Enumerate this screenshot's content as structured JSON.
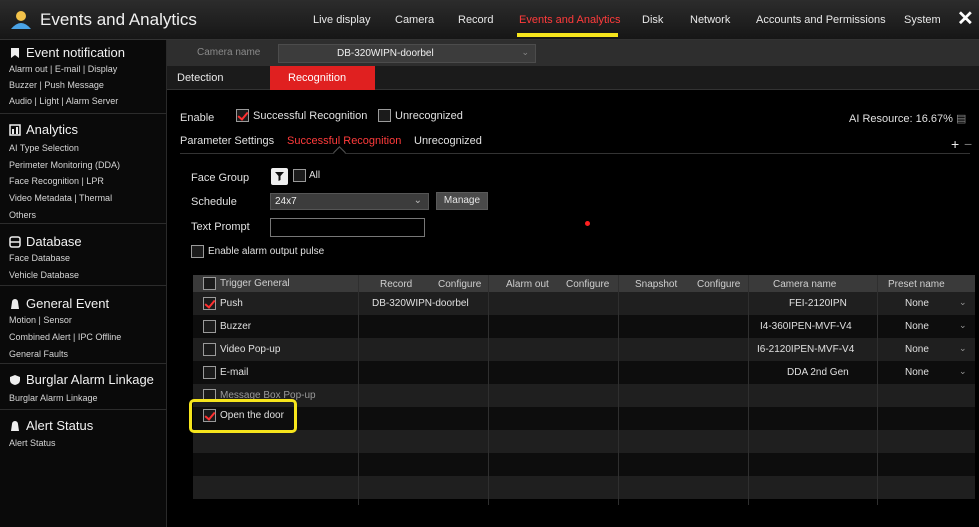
{
  "app": {
    "title": "Events and Analytics"
  },
  "nav": [
    "Live display",
    "Camera",
    "Record",
    "Events and Analytics",
    "Disk",
    "Network",
    "Accounts and Permissions",
    "System"
  ],
  "nav_active_index": 3,
  "close": "✕",
  "sidebar": {
    "sections": [
      {
        "title": "Event notification",
        "icon": "event-notification-icon",
        "items": [
          "Alarm out | E-mail | Display",
          "Buzzer | Push Message",
          "Audio | Light | Alarm Server"
        ]
      },
      {
        "title": "Analytics",
        "icon": "analytics-icon",
        "items": [
          "AI Type Selection",
          "Perimeter Monitoring (DDA)",
          "Face Recognition | LPR",
          "Video Metadata | Thermal",
          "Others"
        ]
      },
      {
        "title": "Database",
        "icon": "database-icon",
        "items": [
          "Face Database",
          "Vehicle Database"
        ]
      },
      {
        "title": "General Event",
        "icon": "general-event-icon",
        "items": [
          "Motion | Sensor",
          "Combined Alert | IPC Offline",
          "General Faults"
        ]
      },
      {
        "title": "Burglar Alarm Linkage",
        "icon": "shield-icon",
        "items": [
          "Burglar Alarm Linkage"
        ]
      },
      {
        "title": "Alert Status",
        "icon": "alert-status-icon",
        "items": [
          "Alert Status"
        ]
      }
    ]
  },
  "camera": {
    "label": "Camera name",
    "value": "DB-320WIPN-doorbel"
  },
  "tabs": {
    "detection": "Detection",
    "recognition": "Recognition"
  },
  "enable": {
    "label": "Enable",
    "successful": {
      "label": "Successful Recognition",
      "checked": true
    },
    "unrecognized": {
      "label": "Unrecognized",
      "checked": false
    },
    "ai_resource": "AI Resource: 16.67%"
  },
  "subtabs": {
    "parameter": "Parameter Settings",
    "successful": "Successful Recognition",
    "unrecognized": "Unrecognized",
    "add": "+",
    "remove": "−"
  },
  "form": {
    "face_group_label": "Face Group",
    "all_label": "All",
    "schedule_label": "Schedule",
    "schedule_value": "24x7",
    "manage_label": "Manage",
    "text_prompt_label": "Text Prompt",
    "text_prompt_value": "",
    "alarm_pulse_label": "Enable alarm output pulse"
  },
  "table": {
    "headers": {
      "trigger": "Trigger General",
      "record": "Record",
      "record_config": "Configure",
      "alarm_out": "Alarm out",
      "alarm_config": "Configure",
      "snapshot": "Snapshot",
      "snapshot_config": "Configure",
      "camera_name": "Camera name",
      "preset_name": "Preset name"
    },
    "triggers": [
      {
        "label": "Push",
        "checked": true
      },
      {
        "label": "Buzzer",
        "checked": false
      },
      {
        "label": "Video Pop-up",
        "checked": false
      },
      {
        "label": "E-mail",
        "checked": false
      },
      {
        "label": "Message Box Pop-up",
        "checked": false
      },
      {
        "label": "Open the door",
        "checked": true
      }
    ],
    "record_values": [
      "DB-320WIPN-doorbel"
    ],
    "presets": [
      {
        "camera": "FEI-2120IPN",
        "preset": "None"
      },
      {
        "camera": "I4-360IPEN-MVF-V4",
        "preset": "None"
      },
      {
        "camera": "I6-2120IPEN-MVF-V4",
        "preset": "None"
      },
      {
        "camera": "DDA 2nd Gen",
        "preset": "None"
      }
    ]
  }
}
